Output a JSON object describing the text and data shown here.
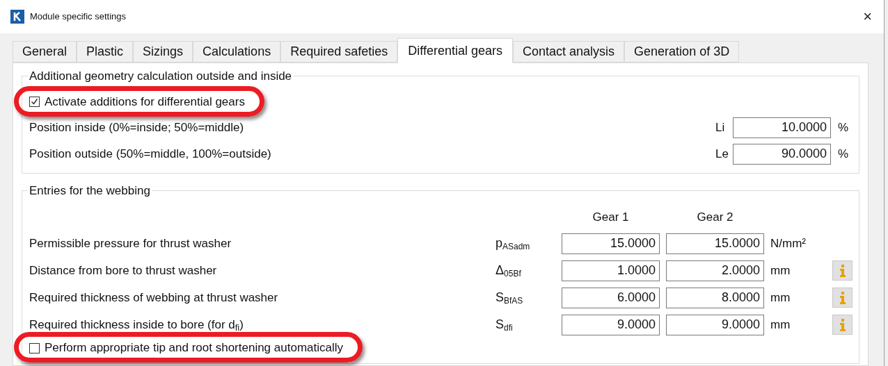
{
  "window": {
    "title": "Module specific settings",
    "close": "×"
  },
  "tabs": [
    {
      "label": "General",
      "selected": false
    },
    {
      "label": "Plastic",
      "selected": false
    },
    {
      "label": "Sizings",
      "selected": false
    },
    {
      "label": "Calculations",
      "selected": false
    },
    {
      "label": "Required safeties",
      "selected": false
    },
    {
      "label": "Differential gears",
      "selected": true
    },
    {
      "label": "Contact analysis",
      "selected": false
    },
    {
      "label": "Generation of 3D",
      "selected": false
    }
  ],
  "geometry_group": {
    "title": "Additional geometry calculation outside and inside",
    "checkbox": {
      "label": "Activate additions for differential gears",
      "checked": true,
      "highlighted": true
    },
    "rows": [
      {
        "label": "Position inside (0%=inside; 50%=middle)",
        "symbol": "Li",
        "value": "10.0000",
        "unit": "%"
      },
      {
        "label": "Position outside (50%=middle, 100%=outside)",
        "symbol": "Le",
        "value": "90.0000",
        "unit": "%"
      }
    ]
  },
  "webbing_group": {
    "title": "Entries for the webbing",
    "columns": [
      "Gear 1",
      "Gear 2"
    ],
    "rows": [
      {
        "label": "Permissible pressure for thrust washer",
        "symbol": "p$_{ASadm}$",
        "gear_1": "15.0000",
        "gear_2": "15.0000",
        "unit": "N/mm²",
        "info": false
      },
      {
        "label": "Distance from bore to thrust washer",
        "symbol": "Δ$_{05Bf}$",
        "gear_1": "1.0000",
        "gear_2": "2.0000",
        "unit": "mm",
        "info": true
      },
      {
        "label": "Required thickness of webbing at thrust washer",
        "symbol": "S$_{BfAS}$",
        "gear_1": "6.0000",
        "gear_2": "8.0000",
        "unit": "mm",
        "info": true
      },
      {
        "label": "Required thickness inside to bore (for d$_{fi}$)",
        "symbol": "S$_{dfi}$",
        "gear_1": "9.0000",
        "gear_2": "9.0000",
        "unit": "mm",
        "info": true
      }
    ],
    "checkbox": {
      "label": "Perform appropriate tip and root shortening automatically",
      "checked": false,
      "highlighted": true
    }
  }
}
